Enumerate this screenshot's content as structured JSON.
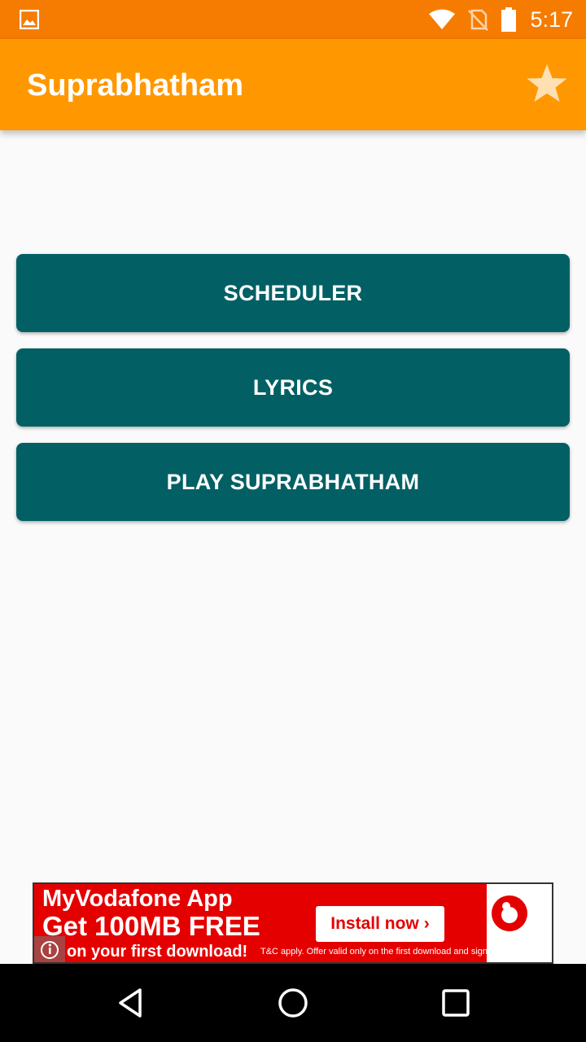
{
  "status_bar": {
    "time": "5:17",
    "icons": [
      "image-notification-icon",
      "wifi-icon",
      "no-sim-icon",
      "battery-icon"
    ]
  },
  "app_bar": {
    "title": "Suprabhatham",
    "action_icon": "star-icon"
  },
  "buttons": [
    {
      "label": "SCHEDULER"
    },
    {
      "label": "LYRICS"
    },
    {
      "label": "PLAY SUPRABHATHAM"
    }
  ],
  "ad": {
    "line1": "MyVodafone App",
    "line2": "Get 100MB FREE",
    "line3": "on your first download!",
    "cta": "Install now",
    "terms": "T&C apply. Offer valid only on the first download and sign-in."
  },
  "nav_bar": {
    "icons": [
      "back-icon",
      "home-icon",
      "recents-icon"
    ]
  },
  "colors": {
    "status_bar": "#f57c00",
    "app_bar": "#ff9800",
    "button": "#026064",
    "background": "#fafafa",
    "ad_red": "#e50000"
  }
}
